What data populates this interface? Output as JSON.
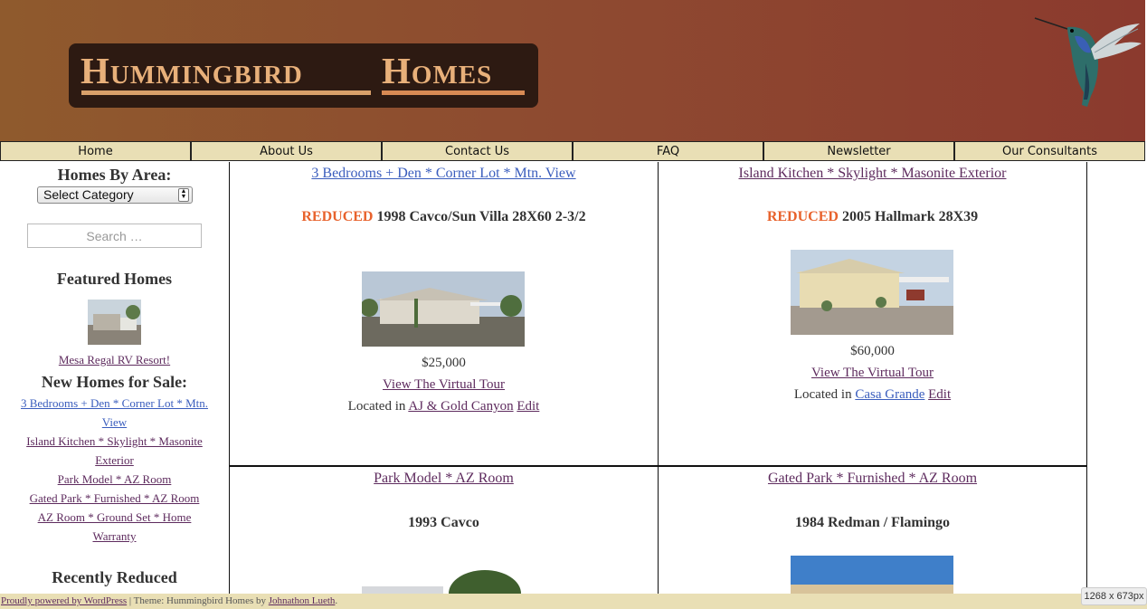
{
  "header": {
    "logo_word1": "Hummingbird",
    "logo_word2": "Homes"
  },
  "nav": [
    "Home",
    "About Us",
    "Contact Us",
    "FAQ",
    "Newsletter",
    "Our Consultants"
  ],
  "sidebar": {
    "homes_by_area_heading": "Homes By Area:",
    "category_select_value": "Select Category",
    "search_placeholder": "Search …",
    "featured_heading": "Featured Homes",
    "featured_link": "Mesa Regal RV Resort!",
    "new_homes_heading": "New Homes for Sale:",
    "new_homes_links": [
      "3 Bedrooms + Den * Corner Lot * Mtn.",
      "View",
      "Island Kitchen * Skylight * Masonite",
      "Exterior",
      "Park Model * AZ Room",
      "Gated Park * Furnished * AZ Room",
      "AZ Room * Ground Set * Home",
      "Warranty"
    ],
    "recently_reduced_heading": "Recently Reduced"
  },
  "listings": [
    {
      "title": "3 Bedrooms + Den * Corner Lot * Mtn. View",
      "badge": "REDUCED",
      "model": "1998 Cavco/Sun Villa 28X60 2-3/2",
      "price": "$25,000",
      "tour": "View The Virtual Tour",
      "located_prefix": "Located in",
      "location": "AJ & Gold Canyon",
      "edit": "Edit"
    },
    {
      "title": "Island Kitchen * Skylight * Masonite Exterior",
      "badge": "REDUCED",
      "model": "2005 Hallmark 28X39",
      "price": "$60,000",
      "tour": "View The Virtual Tour",
      "located_prefix": "Located in",
      "location": "Casa Grande",
      "edit": "Edit"
    },
    {
      "title": "Park Model * AZ Room",
      "model": "1993 Cavco"
    },
    {
      "title": "Gated Park * Furnished * AZ Room",
      "model": "1984  Redman / Flamingo"
    }
  ],
  "footer": {
    "powered": "Proudly powered by WordPress",
    "sep": " | Theme: Hummingbird Homes by ",
    "author": "Johnathon Lueth",
    "end": "."
  },
  "size_badge": "1268 x 673px"
}
